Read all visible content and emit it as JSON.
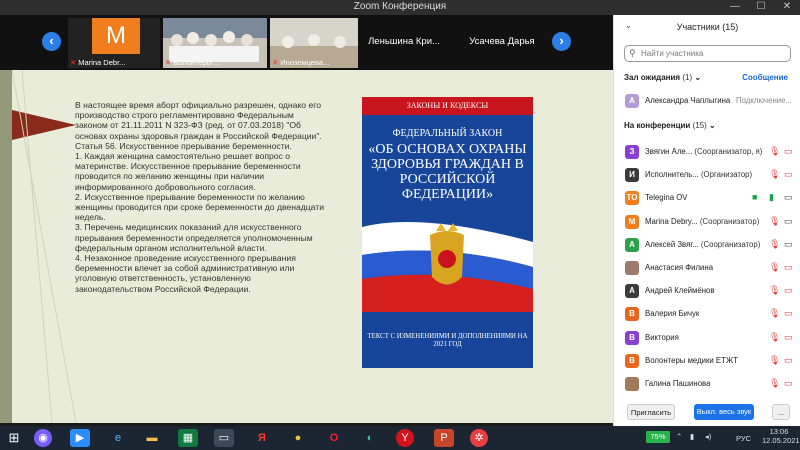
{
  "window": {
    "title": "Zoom Конференция",
    "minimize": "—",
    "maximize": "☐",
    "close": "✕"
  },
  "strip": {
    "prev": "‹",
    "next": "›",
    "tiles": [
      {
        "name": "Marina Debr..."
      },
      {
        "name": "Волонтеры ..."
      },
      {
        "name": "Иноземцева..."
      },
      {
        "name": "Леньшина Кри..."
      },
      {
        "name": "Усачева Дарья"
      }
    ],
    "avatar_letter": "M"
  },
  "slide": {
    "paragraphs": [
      "В настоящее время аборт официально разрешен, однако его производство строго регламентировано Федеральным законом от 21.11.2011 N 323-ФЗ (ред. от 07.03.2018) \"Об основах охраны здоровья граждан в Российской Федерации\".",
      "Статья 56. Искусственное прерывание беременности.",
      "1. Каждая женщина самостоятельно решает вопрос о материнстве. Искусственное прерывание беременности проводится по желанию женщины при наличии информированного добровольного согласия.",
      "2. Искусственное прерывание беременности по желанию женщины проводится при сроке беременности до двенадцати недель.",
      "3. Перечень медицинских показаний для искусственного прерывания беременности определяется уполномоченным федеральным органом исполнительной власти.",
      "4. Незаконное проведение искусственного прерывания беременности влечет за собой административную или уголовную ответственность, установленную законодательством Российской Федерации."
    ],
    "book": {
      "header": "ЗАКОНЫ И КОДЕКСЫ",
      "line1": "ФЕДЕРАЛЬНЫЙ ЗАКОН",
      "line2": "«ОБ ОСНОВАХ ОХРАНЫ ЗДОРОВЬЯ ГРАЖДАН В РОССИЙСКОЙ ФЕДЕРАЦИИ»",
      "footer": "ТЕКСТ С ИЗМЕНЕНИЯМИ И ДОПОЛНЕНИЯМИ НА 2021 ГОД"
    }
  },
  "participants": {
    "title": "Участники (15)",
    "search_placeholder": "Найти участника",
    "waiting": {
      "label": "Зал ожидания",
      "count": "(1)",
      "message_link": "Сообщение"
    },
    "waiting_user": {
      "initial": "А",
      "name": "Александра Чаплыгина",
      "status": "Подключение..."
    },
    "in_meeting": {
      "label": "На конференции",
      "count": "(15)"
    },
    "list": [
      {
        "initial": "З",
        "color": "#8a3fd1",
        "name": "Звягин Але...",
        "role": "(Соорганизатор, я)"
      },
      {
        "initial": "И",
        "color": "#3a3a3a",
        "name": "Исполнитель...",
        "role": "(Организатор)"
      },
      {
        "initial": "TO",
        "color": "#f07e1e",
        "name": "Telegina OV",
        "role": ""
      },
      {
        "initial": "M",
        "color": "#f07e1e",
        "name": "Marina Debry...",
        "role": "(Соорганизатор)"
      },
      {
        "initial": "А",
        "color": "#2aa14a",
        "name": "Алексей Звяг...",
        "role": "(Соорганизатор)"
      },
      {
        "initial": "",
        "color": "#9a7a6a",
        "name": "Анастасия Филина",
        "role": ""
      },
      {
        "initial": "А",
        "color": "#3a3a3a",
        "name": "Андрей Клеймёнов",
        "role": ""
      },
      {
        "initial": "В",
        "color": "#e8661e",
        "name": "Валерия Бичук",
        "role": ""
      },
      {
        "initial": "В",
        "color": "#8a3fd1",
        "name": "Виктория",
        "role": ""
      },
      {
        "initial": "В",
        "color": "#e8661e",
        "name": "Волонтеры медики ЕТЖТ",
        "role": ""
      },
      {
        "initial": "",
        "color": "#a07a5a",
        "name": "Галина Пашинова",
        "role": ""
      }
    ],
    "invite": "Пригласить",
    "mute_all": "Выкл. весь звук",
    "more": "..."
  },
  "taskbar": {
    "battery": "75%",
    "lang": "РУС",
    "time": "13:06",
    "date": "12.05.2021"
  }
}
